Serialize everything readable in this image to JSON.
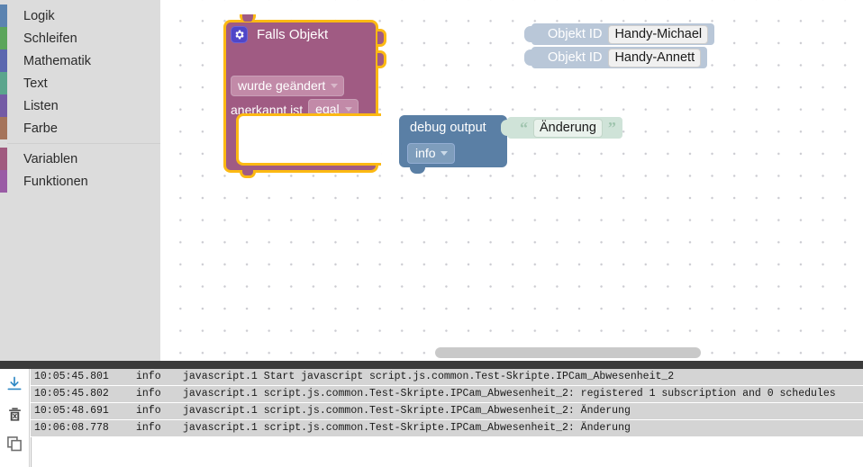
{
  "toolbox": {
    "items": [
      {
        "label": "Logik",
        "color": "#5b83b0"
      },
      {
        "label": "Schleifen",
        "color": "#5ba55b"
      },
      {
        "label": "Mathematik",
        "color": "#5b67af"
      },
      {
        "label": "Text",
        "color": "#5ba58d"
      },
      {
        "label": "Listen",
        "color": "#745ba5"
      },
      {
        "label": "Farbe",
        "color": "#a5745b"
      },
      {
        "label": "Variablen",
        "color": "#a05a7f"
      },
      {
        "label": "Funktionen",
        "color": "#9a5ba5"
      }
    ]
  },
  "workspace": {
    "if_block": {
      "title": "Falls Objekt",
      "gear_icon": "gear-icon",
      "accent_color": "#fcb913",
      "block_color": "#a05b83",
      "trigger_label": "wurde geändert",
      "ack_prefix": "anerkannt ist",
      "ack_value": "egal"
    },
    "object_rows": [
      {
        "label": "Objekt ID",
        "value": "Handy-Michael"
      },
      {
        "label": "Objekt ID",
        "value": "Handy-Annett"
      }
    ],
    "debug_block": {
      "label": "debug output",
      "level": "info",
      "block_color": "#5a7fa5"
    },
    "string_block": {
      "open_quote": "“",
      "close_quote": "”",
      "value": "Änderung",
      "block_color": "#cfe3d8"
    }
  },
  "log": {
    "icons": [
      {
        "name": "download-icon"
      },
      {
        "name": "delete-icon"
      },
      {
        "name": "copy-icon"
      }
    ],
    "rows": [
      {
        "time": "10:05:45.801",
        "level": "info",
        "message": "javascript.1 Start javascript script.js.common.Test-Skripte.IPCam_Abwesenheit_2"
      },
      {
        "time": "10:05:45.802",
        "level": "info",
        "message": "javascript.1 script.js.common.Test-Skripte.IPCam_Abwesenheit_2: registered 1 subscription and 0 schedules"
      },
      {
        "time": "10:05:48.691",
        "level": "info",
        "message": "javascript.1 script.js.common.Test-Skripte.IPCam_Abwesenheit_2: Änderung"
      },
      {
        "time": "10:06:08.778",
        "level": "info",
        "message": "javascript.1 script.js.common.Test-Skripte.IPCam_Abwesenheit_2: Änderung"
      }
    ]
  }
}
